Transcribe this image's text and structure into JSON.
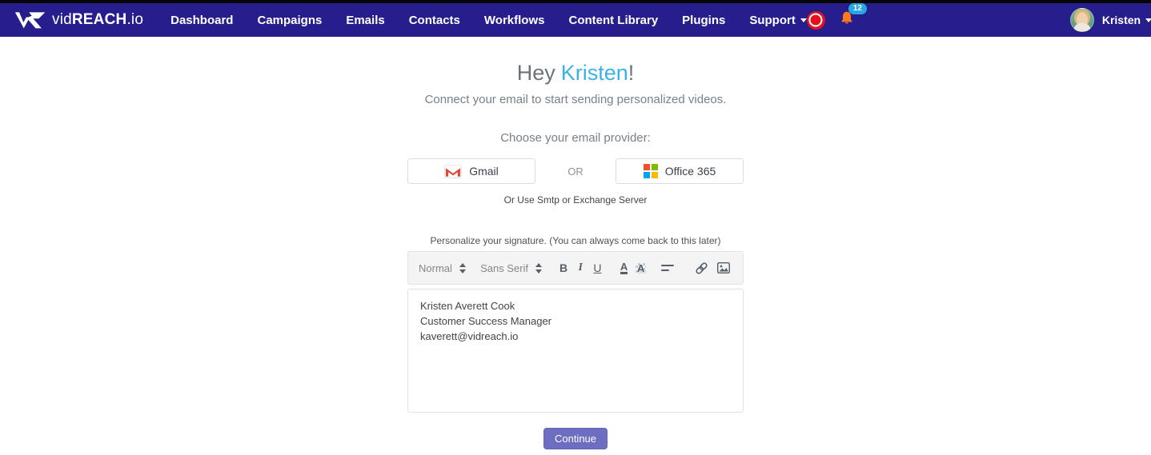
{
  "navbar": {
    "brand": {
      "vid": "vid",
      "reach": "REACH",
      "io": ".io"
    },
    "items": [
      "Dashboard",
      "Campaigns",
      "Emails",
      "Contacts",
      "Workflows",
      "Content Library",
      "Plugins",
      "Support"
    ],
    "notifications": {
      "badge_count": "12"
    },
    "user": {
      "name": "Kristen"
    }
  },
  "main": {
    "greeting": {
      "prefix": "Hey",
      "name": "Kristen",
      "suffix": "!"
    },
    "subtitle": "Connect your email to start sending personalized videos.",
    "provider": {
      "label": "Choose your email provider:",
      "gmail": "Gmail",
      "or": "OR",
      "office": "Office 365",
      "smtp": "Or Use Smtp or Exchange Server"
    },
    "signature": {
      "label": "Personalize your signature. (You can always come back to this later)",
      "toolbar": {
        "format": "Normal",
        "font": "Sans Serif",
        "bold": "B",
        "italic": "I",
        "underline": "U",
        "color": "A",
        "background": "A"
      },
      "lines": [
        "Kristen Averett Cook",
        "Customer Success Manager",
        "kaverett@vidreach.io"
      ]
    },
    "continue": "Continue"
  },
  "colors": {
    "navbar_bg": "#271e8e",
    "accent_blue": "#3cb1e8",
    "button_purple": "#6d6ec2",
    "record_red": "#e60f1e",
    "bell_orange": "#fd7a1c",
    "badge_blue": "#29a7e2"
  }
}
